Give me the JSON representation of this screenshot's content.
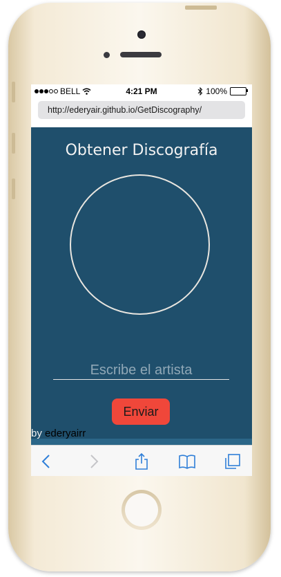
{
  "status": {
    "carrier": "BELL",
    "time": "4:21 PM",
    "battery": "100%"
  },
  "browser": {
    "url": "http://ederyair.github.io/GetDiscography/"
  },
  "page": {
    "title": "Obtener Discografía",
    "artist_placeholder": "Escribe el artista",
    "submit_label": "Enviar",
    "credit_prefix": "by",
    "credit_name": "ederyairr"
  },
  "toolbar": {
    "icons": [
      "back-icon",
      "forward-icon",
      "share-icon",
      "bookmarks-icon",
      "tabs-icon"
    ]
  },
  "colors": {
    "page_bg": "#1f4f6c",
    "button": "#f0473a",
    "accent": "#2f7fd8"
  }
}
